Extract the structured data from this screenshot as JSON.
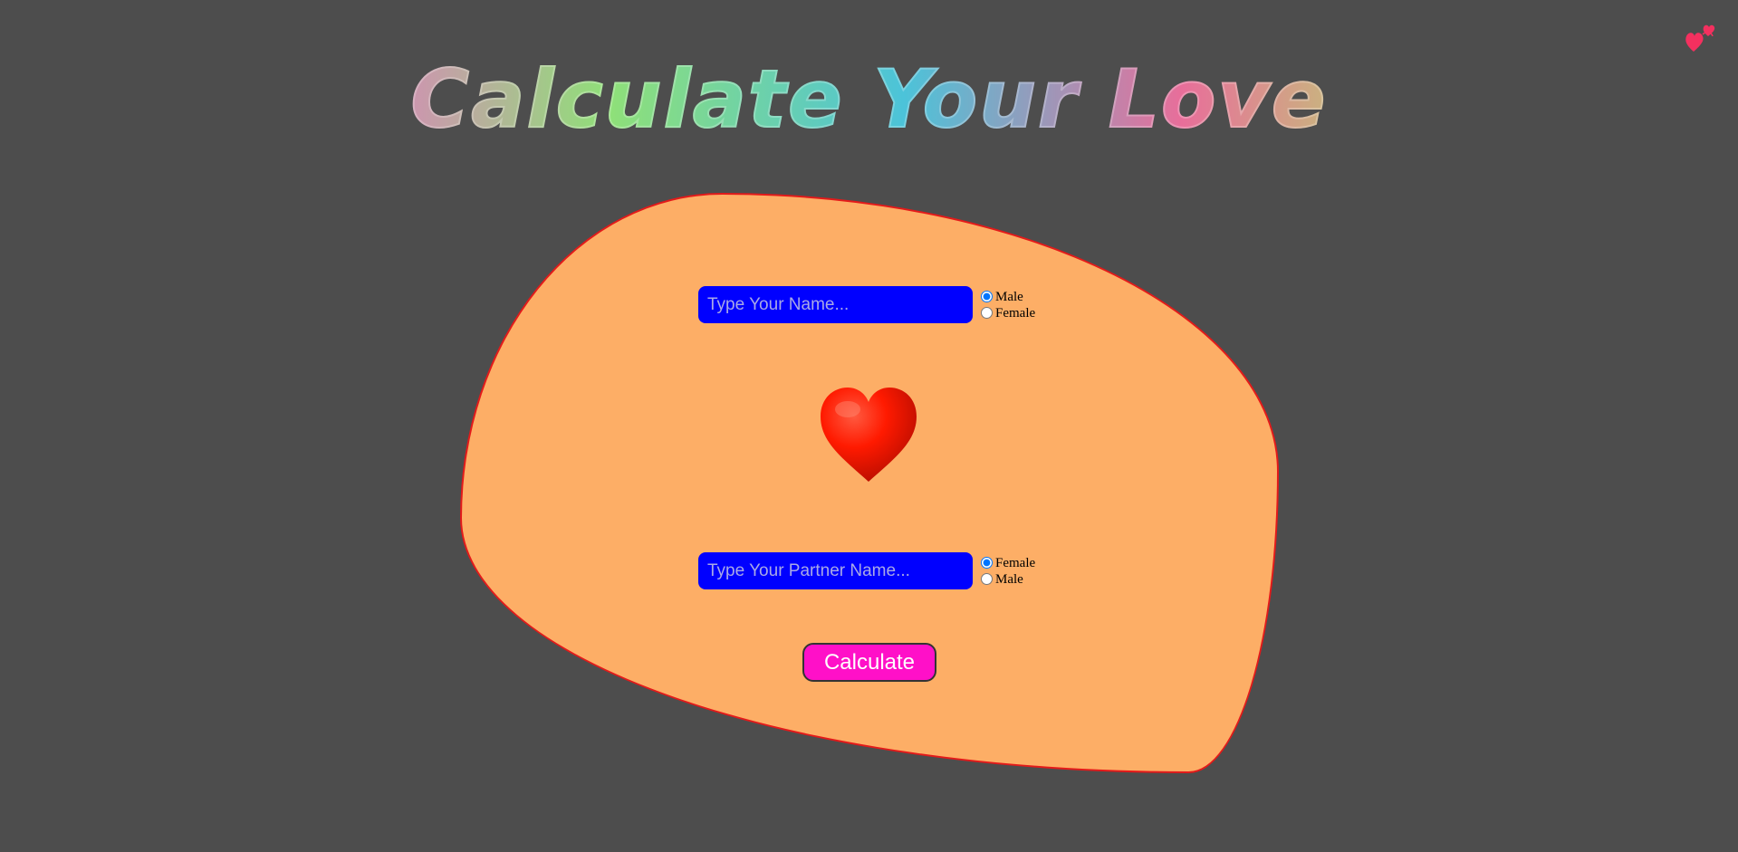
{
  "app": {
    "title": "Calculate Your Love"
  },
  "form": {
    "your_name": {
      "placeholder": "Type Your Name...",
      "value": "",
      "gender_options": [
        {
          "label": "Male",
          "checked": true
        },
        {
          "label": "Female",
          "checked": false
        }
      ]
    },
    "partner_name": {
      "placeholder": "Type Your Partner Name...",
      "value": "",
      "gender_options": [
        {
          "label": "Female",
          "checked": true
        },
        {
          "label": "Male",
          "checked": false
        }
      ]
    },
    "calculate_label": "Calculate"
  },
  "icons": {
    "corner": "hearts-logo-icon",
    "center": "heart-icon"
  },
  "colors": {
    "background": "#4d4d4d",
    "blob": "#fdae66",
    "blob_border": "#e31a1a",
    "input_bg": "#0000ff",
    "button_bg": "#ff10c8",
    "heart": "#ff1a00"
  }
}
